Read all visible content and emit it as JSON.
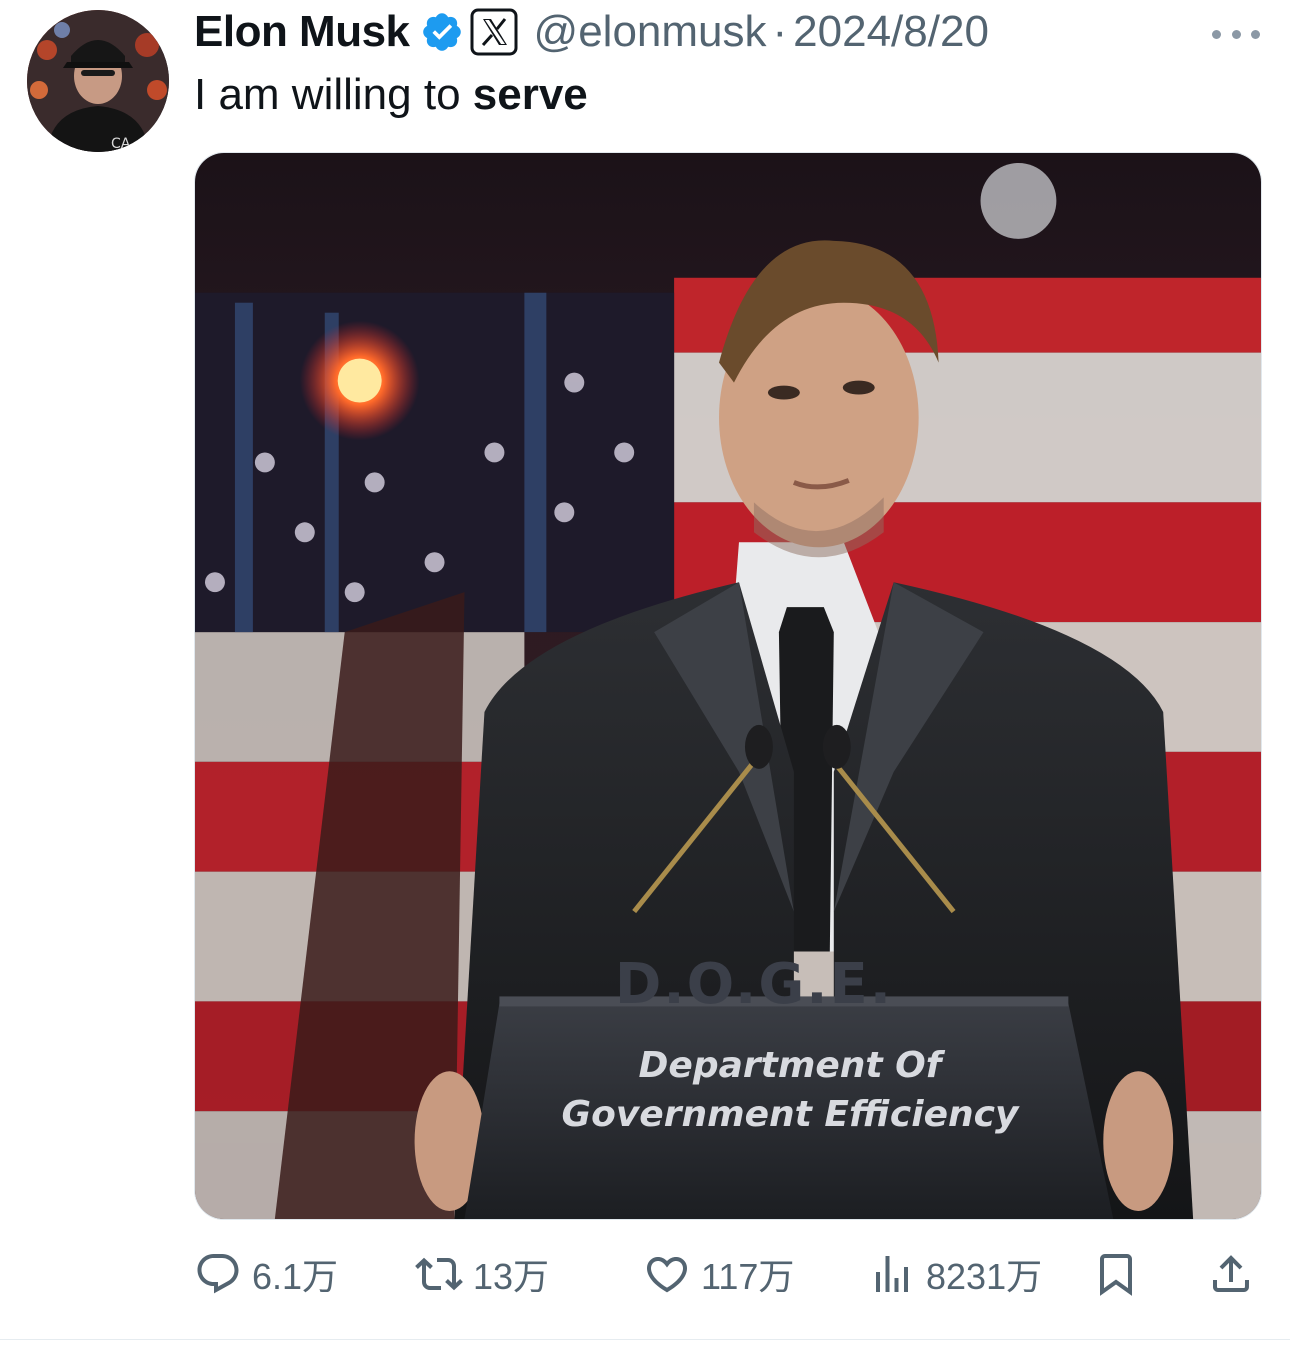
{
  "tweet": {
    "author_name": "Elon Musk",
    "handle": "@elonmusk",
    "separator": "·",
    "date": "2024/8/20",
    "text_prefix": "I am willing to ",
    "text_bold": "serve"
  },
  "media": {
    "podium_acronym": "D.O.G.E.",
    "podium_line1": "Department Of",
    "podium_line2": "Government Efficiency"
  },
  "actions": {
    "replies": "6.1万",
    "retweets": "13万",
    "likes": "117万",
    "views": "8231万"
  },
  "icons": {
    "verified": "verified-badge-icon",
    "x_affiliation": "x-logo-icon",
    "more": "more-icon",
    "reply": "reply-icon",
    "retweet": "retweet-icon",
    "like": "heart-icon",
    "views": "views-icon",
    "bookmark": "bookmark-icon",
    "share": "share-icon"
  },
  "colors": {
    "verified_blue": "#1d9bf0",
    "muted_text": "#536471",
    "text": "#0f1419"
  }
}
